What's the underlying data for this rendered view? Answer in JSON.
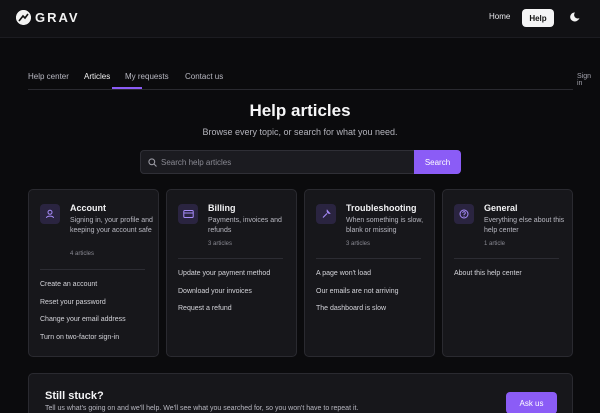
{
  "brand": {
    "name": "GRAV"
  },
  "topnav": {
    "home": "Home",
    "help": "Help"
  },
  "tabs": [
    {
      "label": "Help center"
    },
    {
      "label": "Articles"
    },
    {
      "label": "My requests"
    },
    {
      "label": "Contact us"
    }
  ],
  "signin": "Sign in",
  "hero": {
    "title": "Help articles",
    "subtitle": "Browse every topic, or search for what you need."
  },
  "search": {
    "placeholder": "Search help articles",
    "button": "Search"
  },
  "categories": [
    {
      "title": "Account",
      "description": "Signing in, your profile and keeping your account safe",
      "count": "4 articles",
      "icon": "user-icon",
      "links": [
        "Create an account",
        "Reset your password",
        "Change your email address",
        "Turn on two-factor sign-in"
      ]
    },
    {
      "title": "Billing",
      "description": "Payments, invoices and refunds",
      "count": "3 articles",
      "icon": "credit-card-icon",
      "links": [
        "Update your payment method",
        "Download your invoices",
        "Request a refund"
      ]
    },
    {
      "title": "Troubleshooting",
      "description": "When something is slow, blank or missing",
      "count": "3 articles",
      "icon": "wrench-icon",
      "links": [
        "A page won't load",
        "Our emails are not arriving",
        "The dashboard is slow"
      ]
    },
    {
      "title": "General",
      "description": "Everything else about this help center",
      "count": "1 article",
      "icon": "question-icon",
      "links": [
        "About this help center"
      ]
    }
  ],
  "stuck": {
    "title": "Still stuck?",
    "text": "Tell us what's going on and we'll help. We'll see what you searched for, so you won't have to repeat it.",
    "button": "Ask us"
  },
  "colors": {
    "accent": "#8b5cf6",
    "background": "#0b0b0d",
    "card": "#17171b"
  }
}
